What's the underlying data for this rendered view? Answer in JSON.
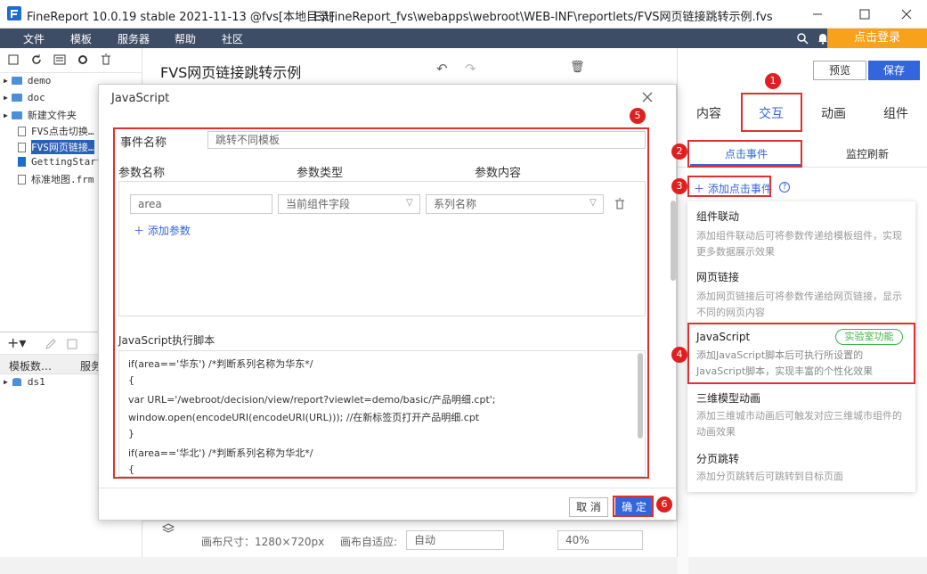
{
  "window": {
    "title": "FineReport 10.0.19 stable 2021-11-13 @fvs[本地目录]",
    "path": "E:\\FineReport_fvs\\webapps\\webroot\\WEB-INF\\reportlets/FVS网页链接跳转示例.fvs"
  },
  "menu": [
    "文件",
    "模板",
    "服务器",
    "帮助",
    "社区"
  ],
  "login": "点击登录",
  "tree": [
    "demo",
    "doc",
    "新建文件夹",
    "FVS点击切换…",
    "FVS网页链接…",
    "GettingStart…",
    "标准地图.frm"
  ],
  "bottom_tabs": [
    "模板数…",
    "服务"
  ],
  "dataset": "ds1",
  "doc_title": "FVS网页链接跳转示例",
  "preview": "预览",
  "save": "保存",
  "right_tabs": [
    "内容",
    "交互",
    "动画",
    "组件"
  ],
  "sub_tabs": [
    "点击事件",
    "监控刷新"
  ],
  "add_event": "添加点击事件",
  "dropdown": [
    {
      "t": "组件联动",
      "d": "添加组件联动后可将参数传递给模板组件，实现更多数据展示效果"
    },
    {
      "t": "网页链接",
      "d": "添加网页链接后可将参数传递给网页链接，显示不同的网页内容"
    },
    {
      "t": "JavaScript",
      "d": "添加JavaScript脚本后可执行所设置的JavaScript脚本，实现丰富的个性化效果",
      "badge": "实验室功能"
    },
    {
      "t": "三维模型动画",
      "d": "添加三维城市动画后可触发对应三维城市组件的动画效果"
    },
    {
      "t": "分页跳转",
      "d": "添加分页跳转后可跳转到目标页面"
    }
  ],
  "dialog": {
    "title": "JavaScript",
    "event_label": "事件名称",
    "event_value": "跳转不同模板",
    "param_headers": [
      "参数名称",
      "参数类型",
      "参数内容"
    ],
    "param": {
      "name": "area",
      "type": "当前组件字段",
      "content": "系列名称"
    },
    "add_param": "添加参数",
    "script_label": "JavaScript执行脚本",
    "code": [
      "if(area=='华东') /*判断系列名称为华东*/",
      "{",
      "var URL='/webroot/decision/view/report?viewlet=demo/basic/产品明细.cpt';",
      "window.open(encodeURI(encodeURI(URL))); //在新标签页打开产品明细.cpt",
      "}",
      "if(area=='华北') /*判断系列名称为华北*/",
      "{"
    ],
    "cancel": "取 消",
    "ok": "确 定"
  },
  "footer": {
    "size": "画布尺寸：1280×720px",
    "adapt_label": "画布自适应:",
    "adapt": "自动",
    "zoom": "40%"
  },
  "callouts": [
    "1",
    "2",
    "3",
    "4",
    "5",
    "6"
  ],
  "colors": {
    "accent": "#3366dd",
    "red": "#e03030",
    "menubar": "#3d4d66",
    "orange": "#f8a21b"
  }
}
